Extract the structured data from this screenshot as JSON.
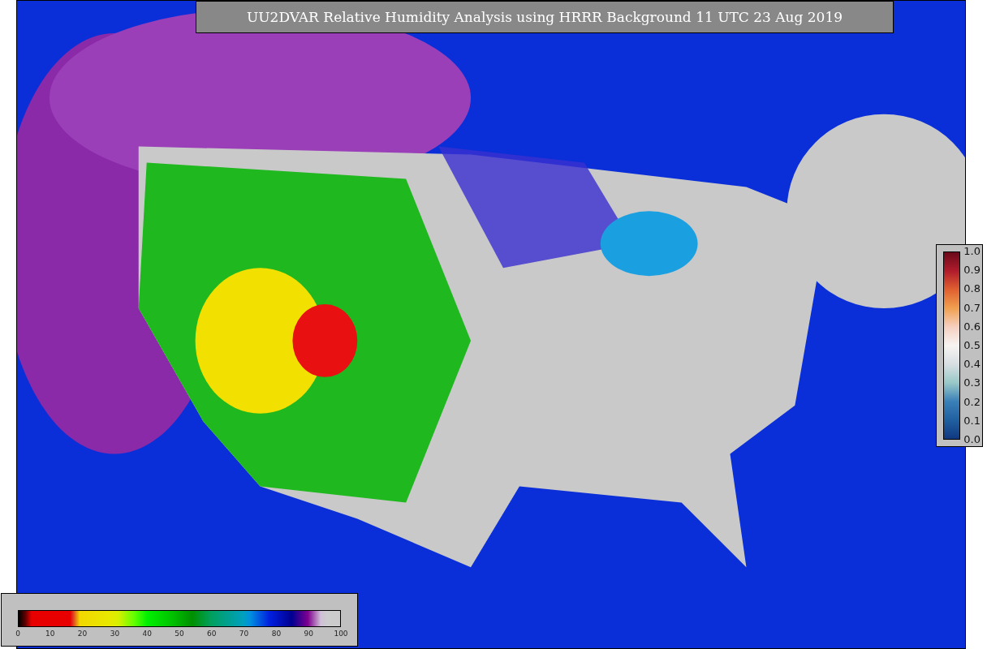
{
  "title": "UU2DVAR Relative Humidity Analysis using HRRR Background 11 UTC 23 Aug 2019",
  "humidity_colorbar": {
    "ticks": [
      "0",
      "10",
      "20",
      "30",
      "40",
      "50",
      "60",
      "70",
      "80",
      "90",
      "100"
    ]
  },
  "station_colorbar": {
    "ticks": [
      "1.0",
      "0.9",
      "0.8",
      "0.7",
      "0.6",
      "0.5",
      "0.4",
      "0.3",
      "0.2",
      "0.1",
      "0.0"
    ]
  }
}
